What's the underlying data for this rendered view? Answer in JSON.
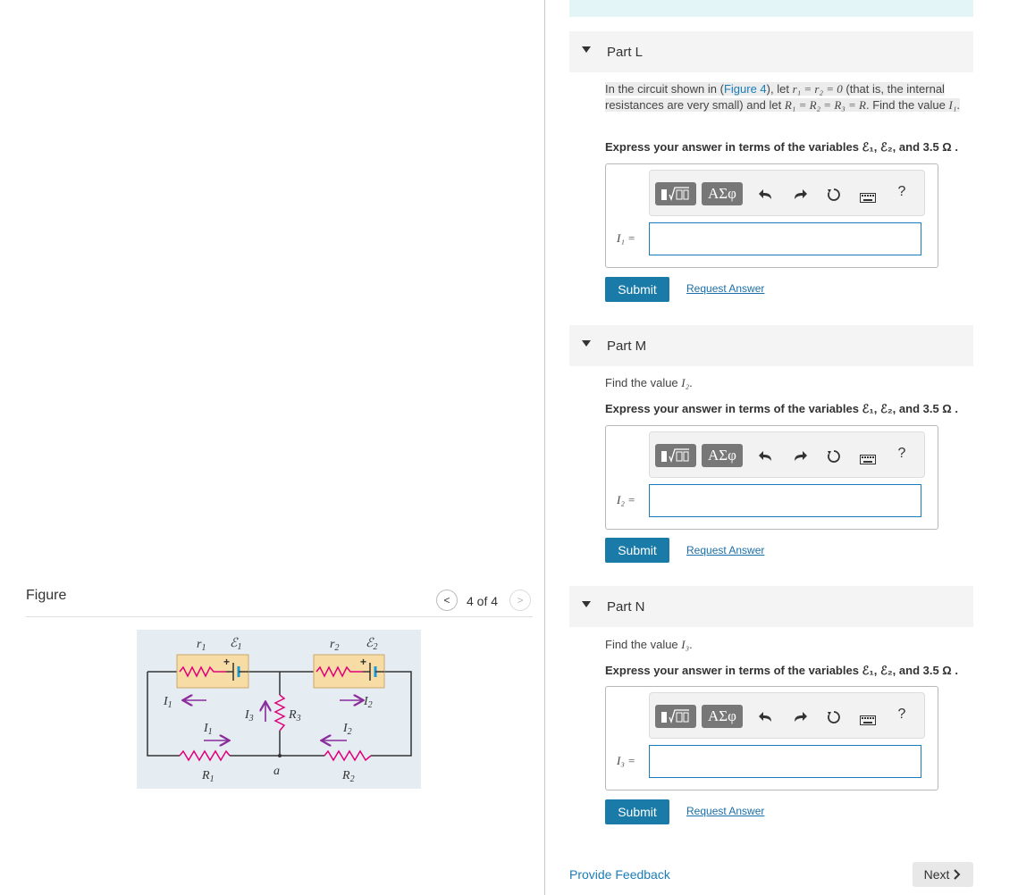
{
  "figure": {
    "title": "Figure",
    "pager": {
      "prev": "<",
      "next": ">",
      "text": "4 of 4"
    },
    "labels": {
      "r1": "r",
      "r1_sub": "1",
      "e1": "ℰ",
      "e1_sub": "1",
      "r2": "r",
      "r2_sub": "2",
      "e2": "ℰ",
      "e2_sub": "2",
      "plus": "+",
      "i1_left": "I",
      "i1_left_sub": "1",
      "i1_mid": "I",
      "i1_mid_sub": "1",
      "i2_top": "I",
      "i2_top_sub": "2",
      "i2_mid": "I",
      "i2_mid_sub": "2",
      "i3": "I",
      "i3_sub": "3",
      "r3": "R",
      "r3_sub": "3",
      "rr1": "R",
      "rr1_sub": "1",
      "rr2": "R",
      "rr2_sub": "2",
      "node": "a"
    }
  },
  "toolbar": {
    "greek": "ΑΣφ",
    "help": "?"
  },
  "parts": [
    {
      "label": "Part L",
      "prompt": {
        "a": "In the circuit shown in (",
        "link": "Figure 4",
        "b": "), let ",
        "m1": "r₁ = r₂ = 0",
        "c": " (that is, the internal resistances are very small) and let ",
        "m2": "R₁ = R₂ = R₃ = R",
        "d": ". Find the value ",
        "m3": "I₁",
        "e": "."
      },
      "express": "Express your answer in terms of the variables ℰ₁, ℰ₂, and 3.5 Ω .",
      "answer_label": "I₁ =",
      "submit": "Submit",
      "request": "Request Answer"
    },
    {
      "label": "Part M",
      "prompt": {
        "a": "Find the value ",
        "m1": "I₂",
        "b": "."
      },
      "express": "Express your answer in terms of the variables ℰ₁, ℰ₂, and 3.5 Ω .",
      "answer_label": "I₂ =",
      "submit": "Submit",
      "request": "Request Answer"
    },
    {
      "label": "Part N",
      "prompt": {
        "a": "Find the value ",
        "m1": "I₃",
        "b": "."
      },
      "express": "Express your answer in terms of the variables ℰ₁, ℰ₂, and 3.5 Ω .",
      "answer_label": "I₃ =",
      "submit": "Submit",
      "request": "Request Answer"
    }
  ],
  "footer": {
    "feedback": "Provide Feedback",
    "next": "Next"
  },
  "colors": {
    "accent": "#1a7aa8",
    "link": "#1a7db8",
    "circuit_bg": "#e5ecf2",
    "resistor": "#e0007a",
    "current_arrow": "#8a2c9c",
    "battery_box": "#f8dca6"
  }
}
